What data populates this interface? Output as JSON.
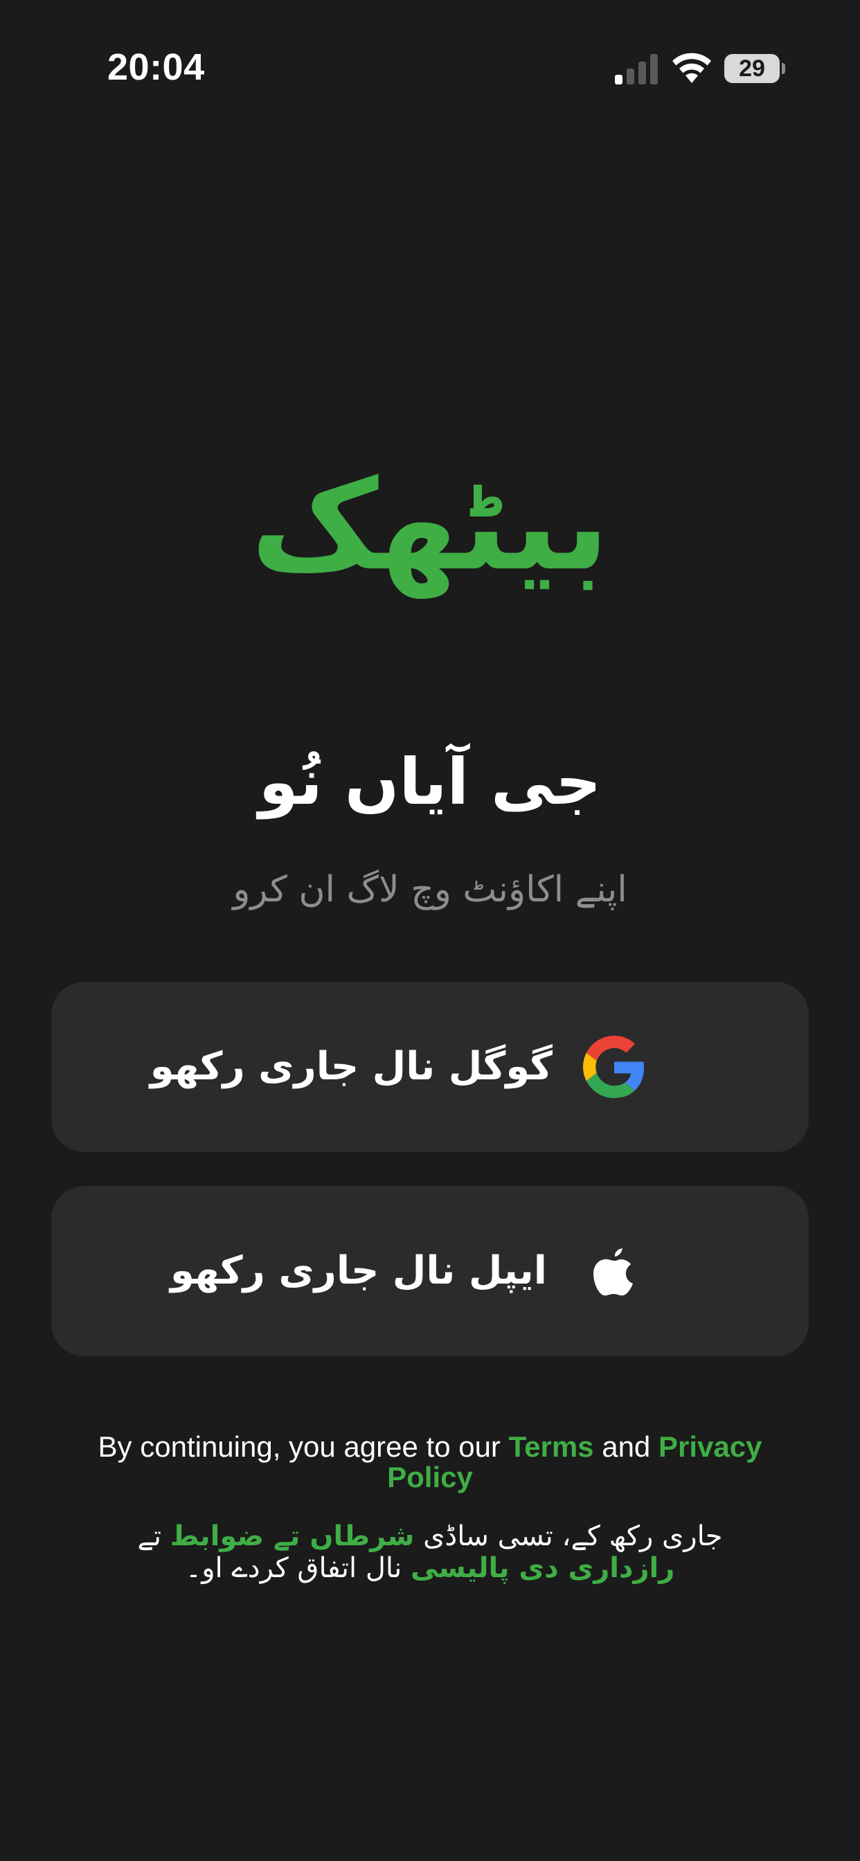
{
  "status_bar": {
    "time": "20:04",
    "battery_level": "29",
    "signal_bars_active": 1,
    "signal_bars_total": 4,
    "icons": [
      "signal-icon",
      "wifi-icon",
      "battery-icon"
    ]
  },
  "brand": {
    "logo_text": "بیٹھک",
    "accent_color": "#3fae45"
  },
  "welcome": {
    "title": "جی آیاں نُو",
    "subtitle": "اپنے اکاؤنٹ وچ لاگ ان کرو"
  },
  "buttons": {
    "google_label": "گوگل نال جاری رکھو",
    "google_icon": "google-logo-icon",
    "apple_label": "ایپل نال جاری رکھو",
    "apple_icon": "apple-logo-icon"
  },
  "terms_en": {
    "prefix": "By continuing, you agree to our ",
    "terms_link": "Terms",
    "and": " and ",
    "privacy_link": "Privacy Policy"
  },
  "terms_ur": {
    "prefix": "جاری رکھ کے، تسی ساڈی ",
    "terms_link": "شرطاں تے ضوابط",
    "and": " تے ",
    "privacy_link": "رازداری دی پالیسی",
    "suffix": " نال اتفاق کردے او۔"
  },
  "colors": {
    "background": "#1b1b1b",
    "button_background": "#2b2b2b",
    "subtitle_text": "#8e8e8e"
  }
}
